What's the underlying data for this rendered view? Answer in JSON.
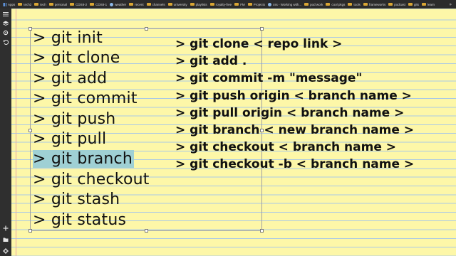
{
  "bookmarks": [
    {
      "label": "Apps",
      "icon": "apps-icon"
    },
    {
      "label": "tech2",
      "icon": "folder-icon"
    },
    {
      "label": "tech",
      "icon": "folder-icon"
    },
    {
      "label": "personal",
      "icon": "folder-icon"
    },
    {
      "label": "CDS8-2",
      "icon": "folder-icon"
    },
    {
      "label": "CDS8-1",
      "icon": "folder-icon"
    },
    {
      "label": "weather",
      "icon": "globe-icon"
    },
    {
      "label": "recent",
      "icon": "folder-icon"
    },
    {
      "label": "channels",
      "icon": "folder-icon"
    },
    {
      "label": "university",
      "icon": "folder-icon"
    },
    {
      "label": "playlists",
      "icon": "folder-icon"
    },
    {
      "label": "royalty-free",
      "icon": "folder-icon"
    },
    {
      "label": "FM",
      "icon": "folder-icon"
    },
    {
      "label": "Projects",
      "icon": "folder-icon"
    },
    {
      "label": "css - Working with...",
      "icon": "globe-icon"
    },
    {
      "label": "pod work",
      "icon": "folder-icon"
    },
    {
      "label": "cool pkgs",
      "icon": "folder-icon"
    },
    {
      "label": "tools",
      "icon": "folder-icon"
    },
    {
      "label": "frameworks",
      "icon": "folder-icon"
    },
    {
      "label": "podcast",
      "icon": "folder-icon"
    },
    {
      "label": "gits",
      "icon": "folder-icon"
    },
    {
      "label": "learn",
      "icon": "folder-icon"
    }
  ],
  "notes": {
    "git_list": [
      "> git init",
      "> git clone",
      "> git add",
      "> git commit",
      "> git push",
      "> git pull",
      "> git branch",
      "> git checkout",
      "> git stash",
      "> git status"
    ],
    "highlighted_index": 6,
    "git_commands": [
      "> git clone < repo link >",
      "> git add .",
      "> git commit -m \"message\"",
      "> git push origin < branch name >",
      "> git pull origin < branch name >",
      "> git branch < new branch name >",
      "> git checkout < branch name >",
      "> git checkout -b < branch name >"
    ]
  },
  "colors": {
    "paper": "#fdf7a8",
    "rule_line": "#a9c8e6",
    "highlight": "#9fd0d4",
    "toolbar": "#2f2f2f"
  }
}
